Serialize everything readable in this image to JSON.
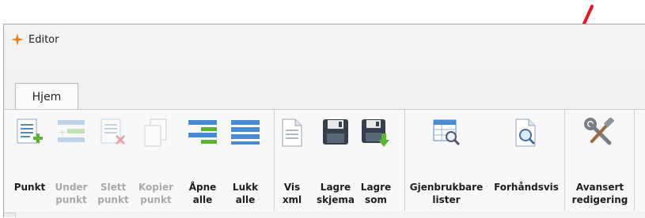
{
  "window": {
    "title": "Editor"
  },
  "tabs": [
    {
      "label": "Hjem",
      "active": true
    }
  ],
  "ribbon": {
    "buttons": [
      {
        "id": "punkt",
        "label": "Punkt",
        "icon": "doc-add-icon",
        "enabled": true
      },
      {
        "id": "under-punkt",
        "label": "Under\npunkt",
        "icon": "sub-item-icon",
        "enabled": false
      },
      {
        "id": "slett-punkt",
        "label": "Slett\npunkt",
        "icon": "doc-delete-icon",
        "enabled": false
      },
      {
        "id": "kopier-punkt",
        "label": "Kopier\npunkt",
        "icon": "copy-icon",
        "enabled": false
      },
      {
        "id": "apne-alle",
        "label": "Åpne\nalle",
        "icon": "expand-all-icon",
        "enabled": true
      },
      {
        "id": "lukk-alle",
        "label": "Lukk\nalle",
        "icon": "collapse-all-icon",
        "enabled": true
      },
      {
        "id": "vis-xml",
        "label": "Vis\nxml",
        "icon": "document-icon",
        "enabled": true
      },
      {
        "id": "lagre-skjema",
        "label": "Lagre\nskjema",
        "icon": "save-icon",
        "enabled": true
      },
      {
        "id": "lagre-som",
        "label": "Lagre\nsom",
        "icon": "save-as-icon",
        "enabled": true
      },
      {
        "id": "gjenbrukbare-lister",
        "label": "Gjenbrukbare\nlister",
        "icon": "table-magnifier-icon",
        "enabled": true
      },
      {
        "id": "forhandsvis",
        "label": "Forhåndsvis",
        "icon": "preview-icon",
        "enabled": true
      },
      {
        "id": "avansert-redigering",
        "label": "Avansert\nredigering",
        "icon": "tools-icon",
        "enabled": true
      }
    ]
  },
  "colors": {
    "arrow": "#e8151b",
    "title_star": "#f07d19",
    "accent_blue": "#4a8bd3",
    "accent_green": "#5cb531"
  }
}
